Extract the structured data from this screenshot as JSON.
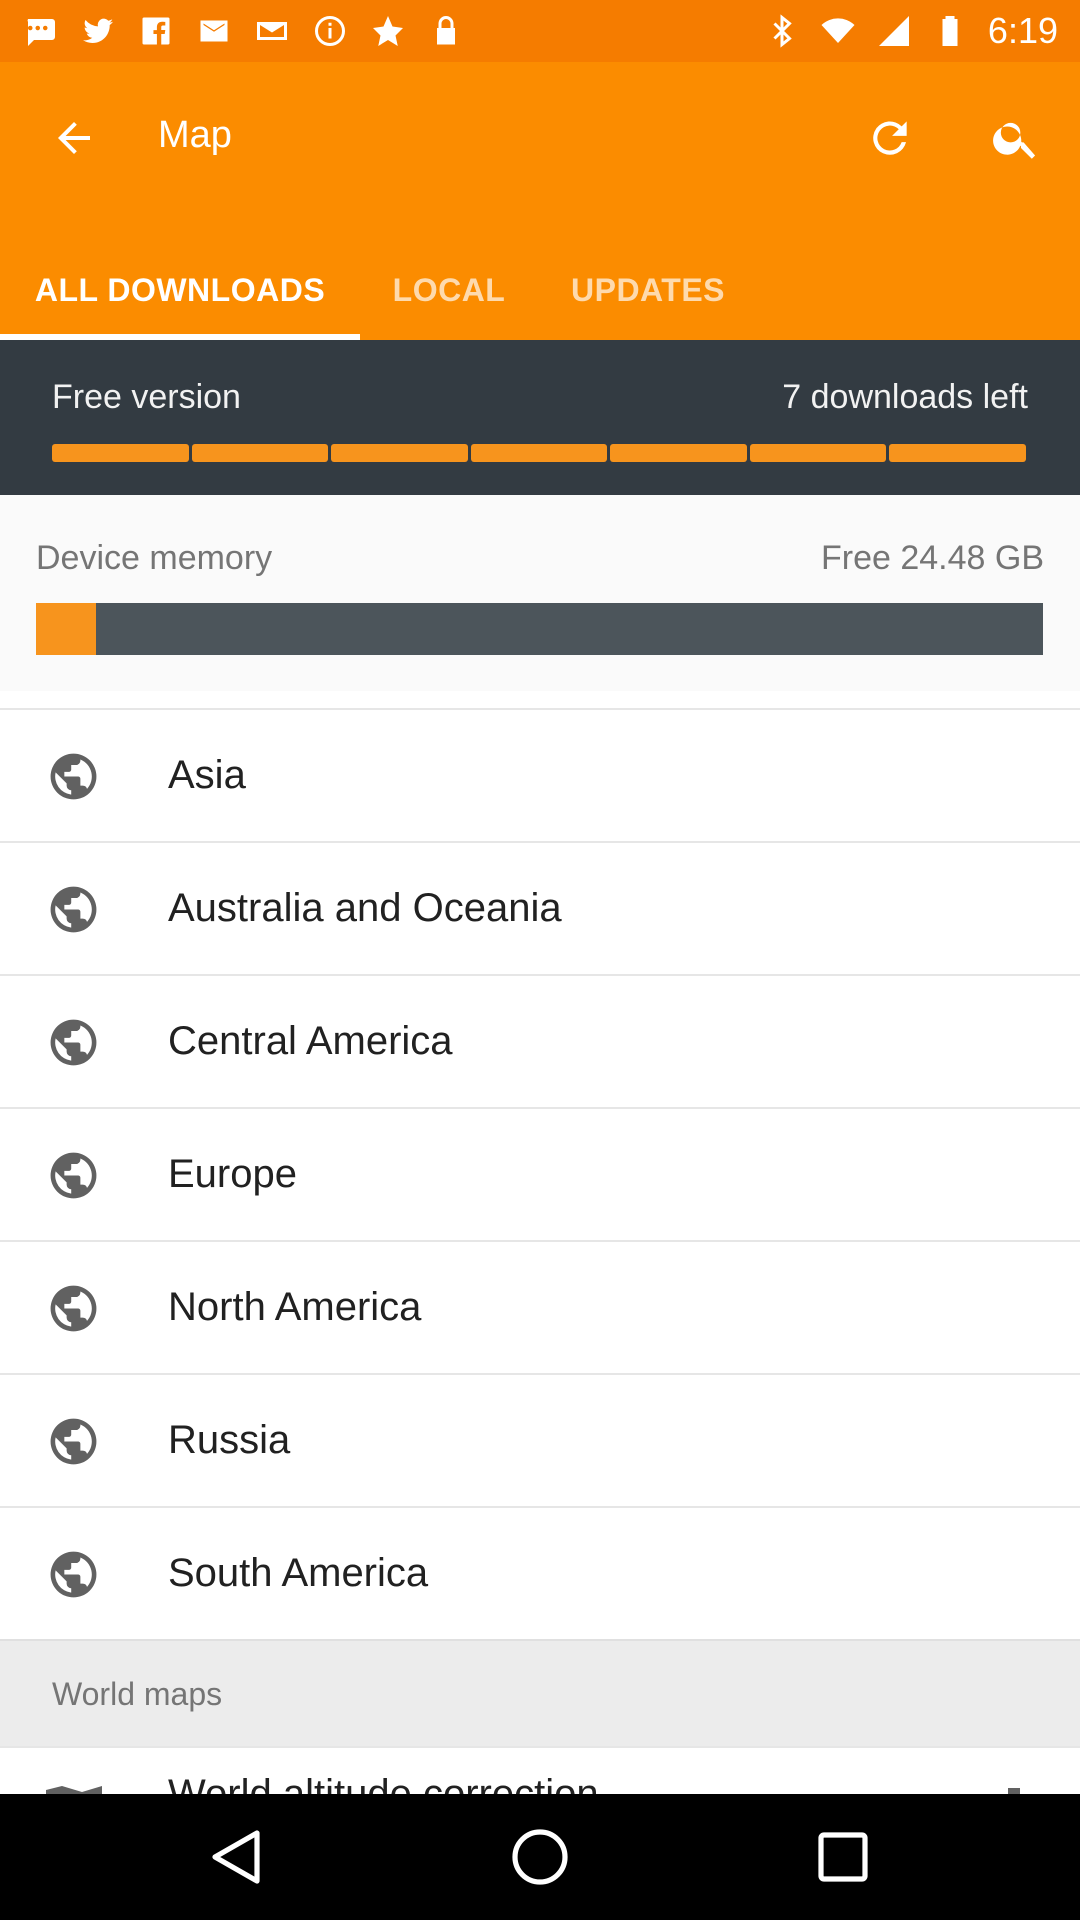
{
  "status_bar": {
    "time": "6:19",
    "left_icons": [
      "message-icon",
      "twitter-icon",
      "facebook-icon",
      "mail-icon",
      "email-icon",
      "info-icon",
      "fake-gps-icon",
      "lock-icon"
    ],
    "right_icons": [
      "bluetooth-icon",
      "wifi-icon",
      "signal-icon",
      "battery-icon"
    ]
  },
  "app_bar": {
    "title": "Map",
    "color": "#fb8c00",
    "actions": [
      "refresh-icon",
      "search-icon"
    ]
  },
  "tabs": [
    {
      "label": "ALL DOWNLOADS",
      "active": true
    },
    {
      "label": "LOCAL",
      "active": false
    },
    {
      "label": "UPDATES",
      "active": false
    }
  ],
  "free_version": {
    "label": "Free version",
    "downloads_left": "7 downloads left",
    "segments_remaining": 7
  },
  "device_memory": {
    "label": "Device memory",
    "free": "Free 24.48 GB",
    "used_fraction": 0.06
  },
  "regions": [
    {
      "label": "Asia"
    },
    {
      "label": "Australia and Oceania"
    },
    {
      "label": "Central America"
    },
    {
      "label": "Europe"
    },
    {
      "label": "North America"
    },
    {
      "label": "Russia"
    },
    {
      "label": "South America"
    }
  ],
  "world_maps": {
    "header": "World maps",
    "first_item": "World altitude correction"
  },
  "colors": {
    "accent": "#f7941d",
    "dark_panel": "#333b42"
  }
}
